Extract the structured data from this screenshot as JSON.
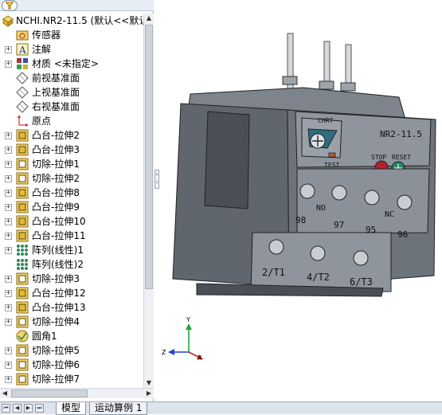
{
  "tree": {
    "root_label": "NCHI.NR2-11.5  (默认<<默认",
    "items": [
      {
        "label": "传感器",
        "icon": "sensor-folder-icon",
        "expander": ""
      },
      {
        "label": "注解",
        "icon": "annotation-icon",
        "expander": "+"
      },
      {
        "label": "材质 <未指定>",
        "icon": "material-icon",
        "expander": "+"
      },
      {
        "label": "前视基准面",
        "icon": "plane-icon",
        "expander": ""
      },
      {
        "label": "上视基准面",
        "icon": "plane-icon",
        "expander": ""
      },
      {
        "label": "右视基准面",
        "icon": "plane-icon",
        "expander": ""
      },
      {
        "label": "原点",
        "icon": "origin-icon",
        "expander": ""
      },
      {
        "label": "凸台-拉伸2",
        "icon": "boss-extrude-icon",
        "expander": "+"
      },
      {
        "label": "凸台-拉伸3",
        "icon": "boss-extrude-icon",
        "expander": "+"
      },
      {
        "label": "切除-拉伸1",
        "icon": "cut-extrude-icon",
        "expander": "+"
      },
      {
        "label": "切除-拉伸2",
        "icon": "cut-extrude-icon",
        "expander": "+"
      },
      {
        "label": "凸台-拉伸8",
        "icon": "boss-extrude-icon",
        "expander": "+"
      },
      {
        "label": "凸台-拉伸9",
        "icon": "boss-extrude-icon",
        "expander": "+"
      },
      {
        "label": "凸台-拉伸10",
        "icon": "boss-extrude-icon",
        "expander": "+"
      },
      {
        "label": "凸台-拉伸11",
        "icon": "boss-extrude-icon",
        "expander": "+"
      },
      {
        "label": "阵列(线性)1",
        "icon": "linear-pattern-icon",
        "expander": "+"
      },
      {
        "label": "阵列(线性)2",
        "icon": "linear-pattern-icon",
        "expander": ""
      },
      {
        "label": "切除-拉伸3",
        "icon": "cut-extrude-icon",
        "expander": "+"
      },
      {
        "label": "凸台-拉伸12",
        "icon": "boss-extrude-icon",
        "expander": "+"
      },
      {
        "label": "凸台-拉伸13",
        "icon": "boss-extrude-icon",
        "expander": "+"
      },
      {
        "label": "切除-拉伸4",
        "icon": "cut-extrude-icon",
        "expander": "+"
      },
      {
        "label": "圆角1",
        "icon": "fillet-icon",
        "expander": ""
      },
      {
        "label": "切除-拉伸5",
        "icon": "cut-extrude-icon",
        "expander": "+"
      },
      {
        "label": "切除-拉伸6",
        "icon": "cut-extrude-icon",
        "expander": "+"
      },
      {
        "label": "切除-拉伸7",
        "icon": "cut-extrude-icon",
        "expander": "+"
      }
    ]
  },
  "model": {
    "model_number": "NR2-11.5",
    "dial_label": "CHRT",
    "test_label": "TEST",
    "stop_label": "STOP",
    "reset_label": "RESET",
    "no_label": "NO",
    "nc_label": "NC",
    "terminals_top": [
      "98",
      "97",
      "95",
      "96"
    ],
    "terminals_bottom": [
      "2/T1",
      "4/T2",
      "6/T3"
    ]
  },
  "triad": {
    "x": "X",
    "y": "Y",
    "z": "Z"
  },
  "tabs": {
    "model": "模型",
    "motion_study": "运动算例 1"
  },
  "colors": {
    "body": "#6f7680",
    "body_dark": "#4a4f57",
    "face_light": "#8e959d",
    "reset_button": "#1f8a62",
    "stop_button": "#b0212b"
  }
}
